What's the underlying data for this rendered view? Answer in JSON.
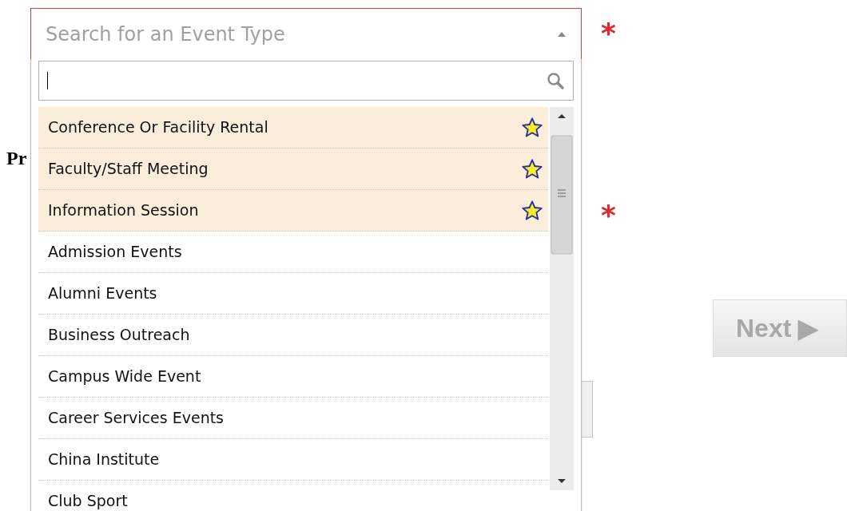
{
  "page": {
    "heading_fragment": "Pr",
    "required_marks": [
      "*",
      "*"
    ]
  },
  "next_button": {
    "label": "Next ▶",
    "disabled": true
  },
  "event_type_select": {
    "placeholder": "Search for an Event Type",
    "expanded": true,
    "invalid": true,
    "items": [
      {
        "label": "Conference Or Facility Rental",
        "favorite": true
      },
      {
        "label": "Faculty/Staff Meeting",
        "favorite": true
      },
      {
        "label": "Information Session",
        "favorite": true
      },
      {
        "label": "Admission Events",
        "favorite": false
      },
      {
        "label": "Alumni Events",
        "favorite": false
      },
      {
        "label": "Business Outreach",
        "favorite": false
      },
      {
        "label": "Campus Wide Event",
        "favorite": false
      },
      {
        "label": "Career Services Events",
        "favorite": false
      },
      {
        "label": "China Institute",
        "favorite": false
      },
      {
        "label": "Club Sport",
        "favorite": false
      }
    ]
  }
}
